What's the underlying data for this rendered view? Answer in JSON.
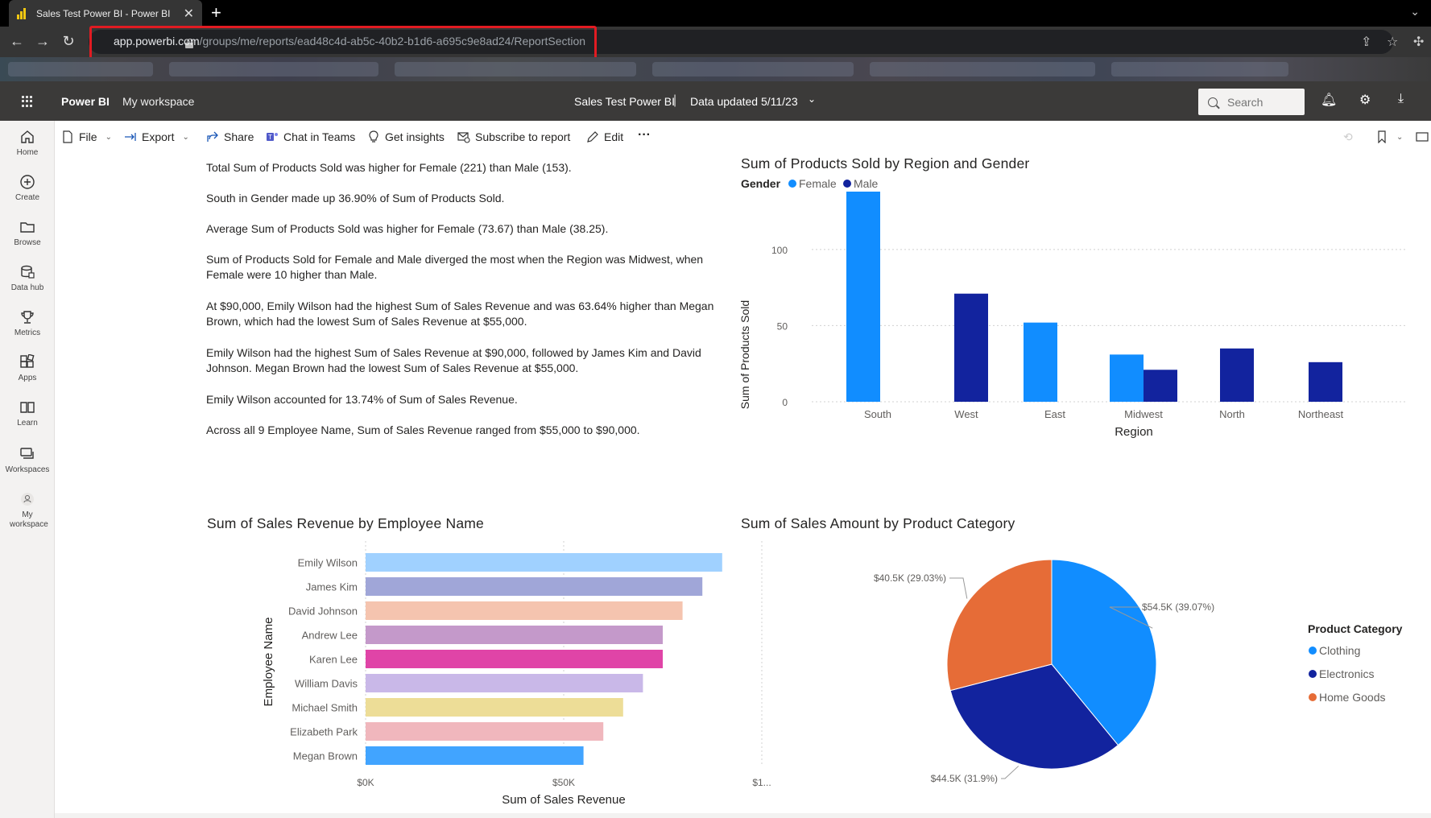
{
  "browser": {
    "tab_title": "Sales Test Power BI - Power BI",
    "url_domain": "app.powerbi.com",
    "url_path": "/groups/me/reports/ead48c4d-ab5c-40b2-b1d6-a695c9e8ad24/ReportSection",
    "new_tab_label": "+",
    "close_label": "✕"
  },
  "header": {
    "brand": "Power BI",
    "workspace": "My workspace",
    "report_title": "Sales Test Power BI",
    "separator": "|",
    "data_updated": "Data updated 5/11/23",
    "search_placeholder": "Search"
  },
  "leftnav": [
    {
      "label": "Home",
      "icon": "home-icon"
    },
    {
      "label": "Create",
      "icon": "create-icon"
    },
    {
      "label": "Browse",
      "icon": "folder-icon"
    },
    {
      "label": "Data hub",
      "icon": "data-hub-icon"
    },
    {
      "label": "Metrics",
      "icon": "trophy-icon"
    },
    {
      "label": "Apps",
      "icon": "apps-icon"
    },
    {
      "label": "Learn",
      "icon": "book-icon"
    },
    {
      "label": "Workspaces",
      "icon": "workspaces-icon"
    },
    {
      "label": "My workspace",
      "icon": "person-icon"
    }
  ],
  "toolbar": {
    "file": "File",
    "export": "Export",
    "share": "Share",
    "chat_in_teams": "Chat in Teams",
    "get_insights": "Get insights",
    "subscribe": "Subscribe to report",
    "edit": "Edit",
    "more": "···"
  },
  "narrative": [
    "Total Sum of Products Sold was higher for Female (221) than Male (153).",
    "South in Gender  made up 36.90% of Sum of Products Sold.",
    "Average Sum of Products Sold was higher for Female (73.67) than Male (38.25).",
    "Sum of Products Sold for Female and Male diverged the most when the Region was Midwest, when Female were 10 higher than Male.",
    "At $90,000, Emily Wilson had the highest Sum of Sales Revenue and was 63.64% higher than Megan Brown, which had the lowest Sum of Sales Revenue at $55,000.",
    "Emily Wilson had the highest Sum of Sales Revenue at $90,000, followed by James Kim and David Johnson. Megan Brown had the lowest Sum of Sales Revenue at $55,000.",
    "Emily Wilson accounted for 13.74% of Sum of Sales Revenue.",
    "Across all 9 Employee Name, Sum of Sales Revenue ranged from $55,000 to $90,000."
  ],
  "chart_data": [
    {
      "type": "bar",
      "orientation": "vertical",
      "title": "Sum of Products Sold by Region and Gender",
      "legend_title": "Gender",
      "legend_position": "top-left",
      "xlabel": "Region",
      "ylabel": "Sum of Products Sold",
      "categories": [
        "South",
        "West",
        "East",
        "Midwest",
        "North",
        "Northeast"
      ],
      "series": [
        {
          "name": "Female",
          "color": "#118dff",
          "values": [
            138,
            null,
            52,
            31,
            null,
            null
          ]
        },
        {
          "name": "Male",
          "color": "#12239e",
          "values": [
            null,
            71,
            null,
            21,
            35,
            26
          ]
        }
      ],
      "yticks": [
        0,
        50,
        100
      ],
      "ylim": [
        0,
        138
      ],
      "grid": true
    },
    {
      "type": "bar",
      "orientation": "horizontal",
      "title": "Sum of Sales Revenue by Employee Name",
      "xlabel": "Sum of Sales Revenue",
      "ylabel": "Employee Name",
      "categories": [
        "Emily Wilson",
        "James Kim",
        "David Johnson",
        "Andrew Lee",
        "Karen Lee",
        "William Davis",
        "Michael Smith",
        "Elizabeth Park",
        "Megan Brown"
      ],
      "values": [
        90000,
        85000,
        80000,
        75000,
        75000,
        70000,
        65000,
        60000,
        55000
      ],
      "colors": [
        "#a0d1ff",
        "#a0a6d8",
        "#f5c4af",
        "#c499ca",
        "#e044a7",
        "#c9b8e8",
        "#eddd97",
        "#f0b7bd",
        "#41a4ff"
      ],
      "xticks": [
        "$0K",
        "$50K",
        "$1..."
      ],
      "xlim": [
        0,
        100000
      ],
      "grid": true
    },
    {
      "type": "pie",
      "title": "Sum of Sales Amount by Product Category",
      "legend_title": "Product Category",
      "legend_position": "right",
      "slices": [
        {
          "name": "Clothing",
          "value": 54500,
          "label": "$54.5K (39.07%)",
          "color": "#118dff"
        },
        {
          "name": "Electronics",
          "value": 44500,
          "label": "$44.5K (31.9%)",
          "color": "#12239e"
        },
        {
          "name": "Home Goods",
          "value": 40500,
          "label": "$40.5K (29.03%)",
          "color": "#e66c37"
        }
      ]
    }
  ]
}
